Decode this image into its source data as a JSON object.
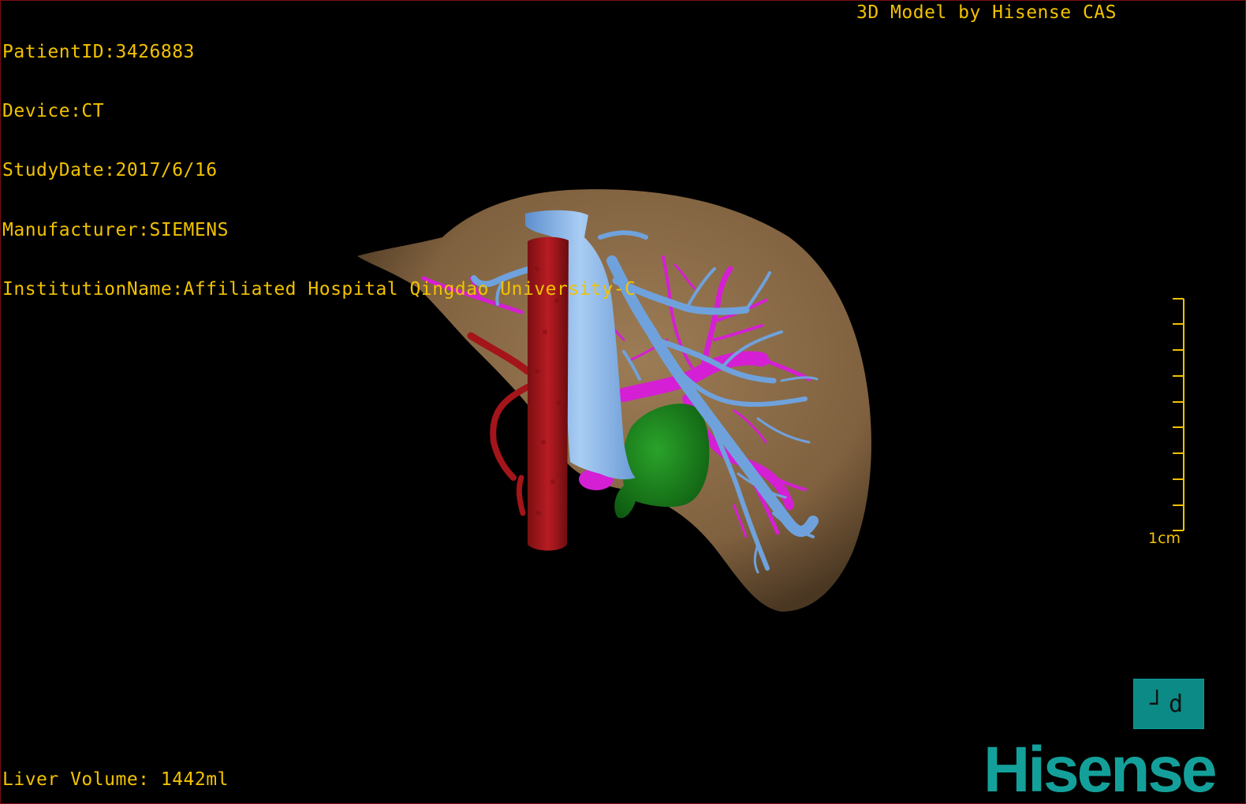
{
  "overlay": {
    "patient_id": "PatientID:3426883",
    "device": "Device:CT",
    "study_date": "StudyDate:2017/6/16",
    "manufacturer": "Manufacturer:SIEMENS",
    "institution": "InstitutionName:Affiliated Hospital Qingdao University-C",
    "credit": "3D Model by Hisense CAS",
    "liver_volume": "Liver Volume: 1442ml"
  },
  "scale_bar": {
    "label": "1cm"
  },
  "controls": {
    "orientation_button": "┘d"
  },
  "brand": {
    "logo_text": "Hisense"
  },
  "model": {
    "structures": [
      "liver",
      "inferior-vena-cava",
      "hepatic-veins",
      "portal-vein",
      "hepatic-artery",
      "aorta",
      "tumor"
    ]
  },
  "colors": {
    "overlay_text": "#f2c200",
    "liver": "#8a6a45",
    "aorta": "#a3151a",
    "hepatic_veins": "#6fa2dc",
    "portal_vein": "#d41fd4",
    "tumor": "#1e8a1e",
    "logo": "#14a09a",
    "border": "#7a0d14"
  }
}
